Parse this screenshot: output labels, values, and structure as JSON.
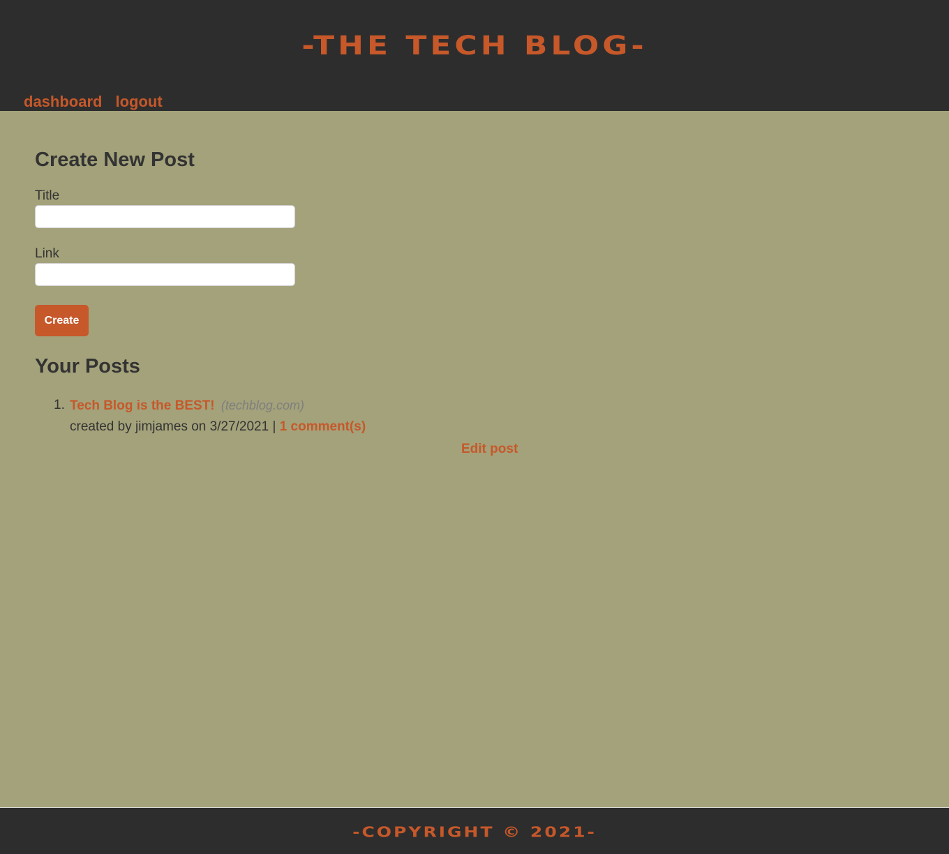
{
  "header": {
    "logo_text": "-THE TECH BLOG-"
  },
  "nav": {
    "dashboard": "dashboard",
    "logout": "logout"
  },
  "create_form": {
    "heading": "Create New Post",
    "title_label": "Title",
    "title_value": "",
    "link_label": "Link",
    "link_value": "",
    "submit_label": "Create"
  },
  "posts": {
    "heading": "Your Posts",
    "items": [
      {
        "number": "1.",
        "title": "Tech Blog is the BEST!",
        "domain": "(techblog.com)",
        "meta": "created by jimjames on 3/27/2021 | ",
        "comments": "1 comment(s)",
        "edit_label": "Edit post"
      }
    ]
  },
  "footer": {
    "text": "-COPYRIGHT © 2021-"
  },
  "colors": {
    "header_bg": "#2d2d2d",
    "page_bg": "#a4a27a",
    "accent": "#c6582a",
    "text": "#333333"
  }
}
